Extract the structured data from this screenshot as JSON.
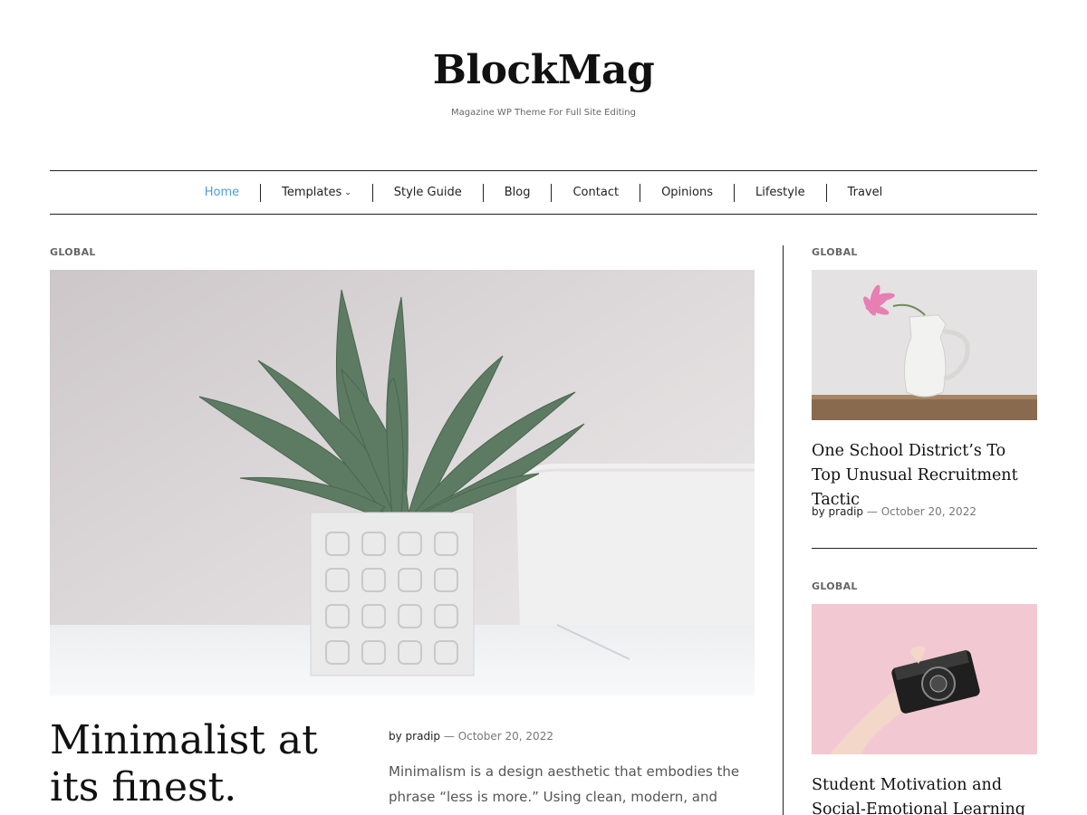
{
  "site": {
    "title": "BlockMag",
    "tagline": "Magazine WP Theme For Full Site Editing"
  },
  "nav": {
    "items": [
      {
        "label": "Home",
        "active": true
      },
      {
        "label": "Templates",
        "has_dropdown": true
      },
      {
        "label": "Style Guide"
      },
      {
        "label": "Blog"
      },
      {
        "label": "Contact"
      },
      {
        "label": "Opinions"
      },
      {
        "label": "Lifestyle"
      },
      {
        "label": "Travel"
      }
    ],
    "active_color": "#4a9fd5",
    "dropdown_icon": "chevron-down-icon"
  },
  "featured": {
    "category": "GLOBAL",
    "title": "Minimalist at its finest.",
    "author_prefix": "by",
    "author": "pradip",
    "date_separator": "—",
    "date": "October 20, 2022",
    "excerpt": "Minimalism is a design aesthetic that embodies the phrase “less is more.” Using clean, modern, and minimal materials for a calm and clutter-free",
    "image": "succulent plant in white textured pot"
  },
  "sidebar": {
    "posts": [
      {
        "category": "GLOBAL",
        "title": "One School District’s To Top Unusual Recruitment Tactic",
        "author_prefix": "by",
        "author": "pradip",
        "date_separator": "—",
        "date": "October 20, 2022",
        "image": "white pitcher with pink flower"
      },
      {
        "category": "GLOBAL",
        "title": "Student Motivation and Social-Emotional Learning Present",
        "image": "hand holding camera on pink background"
      }
    ]
  }
}
